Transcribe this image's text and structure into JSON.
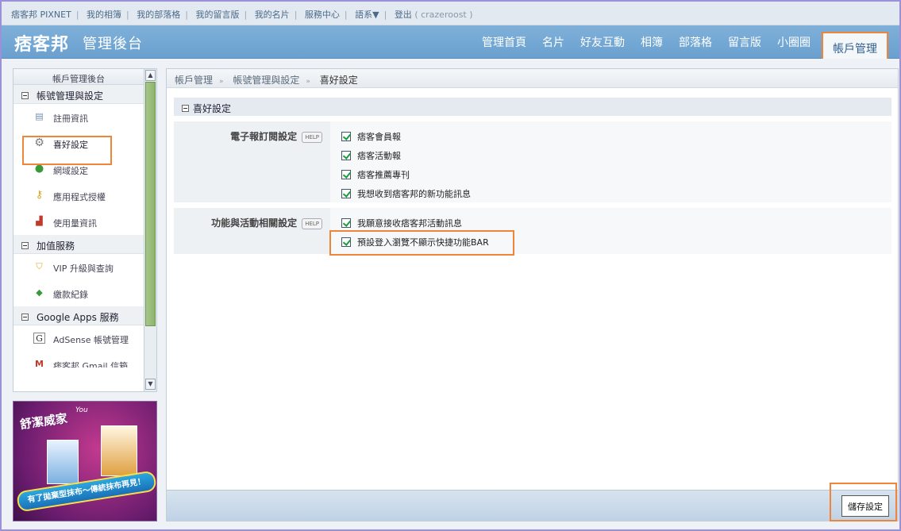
{
  "topnav": {
    "links": [
      "痞客邦 PIXNET",
      "我的相簿",
      "我的部落格",
      "我的留言版",
      "我的名片",
      "服務中心",
      "語系▼"
    ],
    "logout": "登出",
    "user": "( crazeroost )"
  },
  "header": {
    "logo": "痞客邦",
    "subtitle": "管理後台",
    "nav": [
      "管理首頁",
      "名片",
      "好友互動",
      "相簿",
      "部落格",
      "留言版",
      "小圈圈"
    ],
    "nav_active": "帳戶管理"
  },
  "sidebar": {
    "title": "帳戶管理後台",
    "sections": [
      {
        "title": "帳號管理與設定",
        "items": [
          {
            "label": "註冊資訊",
            "icon": "id-card-icon"
          },
          {
            "label": "喜好設定",
            "icon": "gear-icon"
          },
          {
            "label": "網域設定",
            "icon": "globe-icon"
          },
          {
            "label": "應用程式授權",
            "icon": "key-icon"
          },
          {
            "label": "使用量資訊",
            "icon": "bar-chart-icon"
          }
        ]
      },
      {
        "title": "加值服務",
        "items": [
          {
            "label": "VIP 升級與查詢",
            "icon": "shield-icon"
          },
          {
            "label": "繳款紀錄",
            "icon": "money-icon"
          }
        ]
      },
      {
        "title": "Google Apps 服務",
        "items": [
          {
            "label": "AdSense 帳號管理",
            "icon": "google-icon"
          },
          {
            "label": "痞客邦 Gmail 信箱",
            "icon": "gmail-icon"
          }
        ]
      }
    ]
  },
  "ad": {
    "brand": "舒潔威家",
    "brand_top": "You",
    "banner": "有了拋棄型抹布～傳統抹布再見！"
  },
  "main": {
    "breadcrumb": [
      "帳戶管理",
      "帳號管理與設定",
      "喜好設定"
    ],
    "section_title": "喜好設定",
    "help_label": "HELP",
    "groups": [
      {
        "label": "電子報訂閱設定",
        "options": [
          "痞客會員報",
          "痞客活動報",
          "痞客推薦專刊",
          "我想收到痞客邦的新功能訊息"
        ]
      },
      {
        "label": "功能與活動相關設定",
        "options": [
          "我願意接收痞客邦活動訊息",
          "預設登入瀏覽不顯示快捷功能BAR"
        ]
      }
    ],
    "save_label": "儲存設定"
  },
  "colors": {
    "highlight": "#f0853a",
    "header": "#6aa0cf",
    "check": "#1b9b3a"
  }
}
